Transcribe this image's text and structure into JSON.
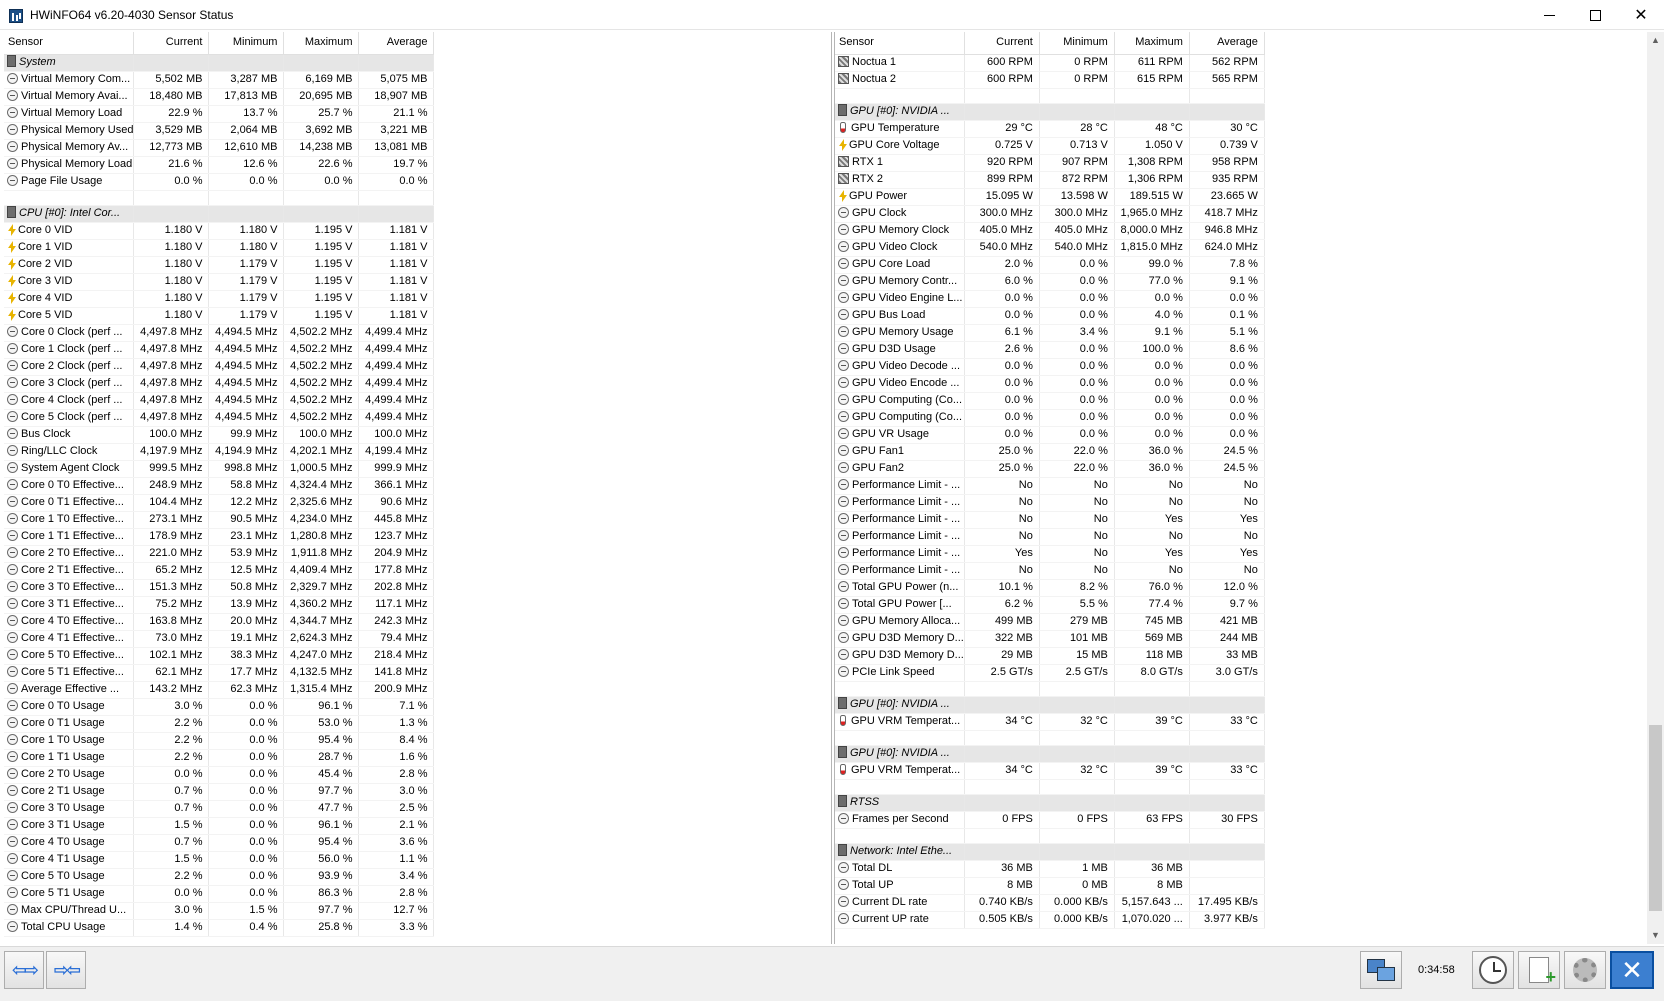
{
  "window": {
    "title": "HWiNFO64 v6.20-4030 Sensor Status"
  },
  "columns": {
    "sensor": "Sensor",
    "current": "Current",
    "minimum": "Minimum",
    "maximum": "Maximum",
    "average": "Average"
  },
  "left_rows": [
    {
      "type": "group",
      "icon": "chip-icon",
      "name": "System"
    },
    {
      "type": "row",
      "icon": "clock-icon",
      "name": "Virtual Memory Com...",
      "cur": "5,502 MB",
      "min": "3,287 MB",
      "max": "6,169 MB",
      "avg": "5,075 MB"
    },
    {
      "type": "row",
      "icon": "clock-icon",
      "name": "Virtual Memory Avai...",
      "cur": "18,480 MB",
      "min": "17,813 MB",
      "max": "20,695 MB",
      "avg": "18,907 MB"
    },
    {
      "type": "row",
      "icon": "clock-icon",
      "name": "Virtual Memory Load",
      "cur": "22.9 %",
      "min": "13.7 %",
      "max": "25.7 %",
      "avg": "21.1 %"
    },
    {
      "type": "row",
      "icon": "clock-icon",
      "name": "Physical Memory Used",
      "cur": "3,529 MB",
      "min": "2,064 MB",
      "max": "3,692 MB",
      "avg": "3,221 MB"
    },
    {
      "type": "row",
      "icon": "clock-icon",
      "name": "Physical Memory Av...",
      "cur": "12,773 MB",
      "min": "12,610 MB",
      "max": "14,238 MB",
      "avg": "13,081 MB"
    },
    {
      "type": "row",
      "icon": "clock-icon",
      "name": "Physical Memory Load",
      "cur": "21.6 %",
      "min": "12.6 %",
      "max": "22.6 %",
      "avg": "19.7 %"
    },
    {
      "type": "row",
      "icon": "clock-icon",
      "name": "Page File Usage",
      "cur": "0.0 %",
      "min": "0.0 %",
      "max": "0.0 %",
      "avg": "0.0 %"
    },
    {
      "type": "blank"
    },
    {
      "type": "group",
      "icon": "chip-icon",
      "name": "CPU [#0]: Intel Cor..."
    },
    {
      "type": "row",
      "icon": "bolt-icon",
      "name": "Core 0 VID",
      "cur": "1.180 V",
      "min": "1.180 V",
      "max": "1.195 V",
      "avg": "1.181 V"
    },
    {
      "type": "row",
      "icon": "bolt-icon",
      "name": "Core 1 VID",
      "cur": "1.180 V",
      "min": "1.180 V",
      "max": "1.195 V",
      "avg": "1.181 V"
    },
    {
      "type": "row",
      "icon": "bolt-icon",
      "name": "Core 2 VID",
      "cur": "1.180 V",
      "min": "1.179 V",
      "max": "1.195 V",
      "avg": "1.181 V"
    },
    {
      "type": "row",
      "icon": "bolt-icon",
      "name": "Core 3 VID",
      "cur": "1.180 V",
      "min": "1.179 V",
      "max": "1.195 V",
      "avg": "1.181 V"
    },
    {
      "type": "row",
      "icon": "bolt-icon",
      "name": "Core 4 VID",
      "cur": "1.180 V",
      "min": "1.179 V",
      "max": "1.195 V",
      "avg": "1.181 V"
    },
    {
      "type": "row",
      "icon": "bolt-icon",
      "name": "Core 5 VID",
      "cur": "1.180 V",
      "min": "1.179 V",
      "max": "1.195 V",
      "avg": "1.181 V"
    },
    {
      "type": "row",
      "icon": "clock-icon",
      "name": "Core 0 Clock (perf ...",
      "cur": "4,497.8 MHz",
      "min": "4,494.5 MHz",
      "max": "4,502.2 MHz",
      "avg": "4,499.4 MHz"
    },
    {
      "type": "row",
      "icon": "clock-icon",
      "name": "Core 1 Clock (perf ...",
      "cur": "4,497.8 MHz",
      "min": "4,494.5 MHz",
      "max": "4,502.2 MHz",
      "avg": "4,499.4 MHz"
    },
    {
      "type": "row",
      "icon": "clock-icon",
      "name": "Core 2 Clock (perf ...",
      "cur": "4,497.8 MHz",
      "min": "4,494.5 MHz",
      "max": "4,502.2 MHz",
      "avg": "4,499.4 MHz"
    },
    {
      "type": "row",
      "icon": "clock-icon",
      "name": "Core 3 Clock (perf ...",
      "cur": "4,497.8 MHz",
      "min": "4,494.5 MHz",
      "max": "4,502.2 MHz",
      "avg": "4,499.4 MHz"
    },
    {
      "type": "row",
      "icon": "clock-icon",
      "name": "Core 4 Clock (perf ...",
      "cur": "4,497.8 MHz",
      "min": "4,494.5 MHz",
      "max": "4,502.2 MHz",
      "avg": "4,499.4 MHz"
    },
    {
      "type": "row",
      "icon": "clock-icon",
      "name": "Core 5 Clock (perf ...",
      "cur": "4,497.8 MHz",
      "min": "4,494.5 MHz",
      "max": "4,502.2 MHz",
      "avg": "4,499.4 MHz"
    },
    {
      "type": "row",
      "icon": "clock-icon",
      "name": "Bus Clock",
      "cur": "100.0 MHz",
      "min": "99.9 MHz",
      "max": "100.0 MHz",
      "avg": "100.0 MHz"
    },
    {
      "type": "row",
      "icon": "clock-icon",
      "name": "Ring/LLC Clock",
      "cur": "4,197.9 MHz",
      "min": "4,194.9 MHz",
      "max": "4,202.1 MHz",
      "avg": "4,199.4 MHz"
    },
    {
      "type": "row",
      "icon": "clock-icon",
      "name": "System Agent Clock",
      "cur": "999.5 MHz",
      "min": "998.8 MHz",
      "max": "1,000.5 MHz",
      "avg": "999.9 MHz"
    },
    {
      "type": "row",
      "icon": "clock-icon",
      "name": "Core 0 T0 Effective...",
      "cur": "248.9 MHz",
      "min": "58.8 MHz",
      "max": "4,324.4 MHz",
      "avg": "366.1 MHz"
    },
    {
      "type": "row",
      "icon": "clock-icon",
      "name": "Core 0 T1 Effective...",
      "cur": "104.4 MHz",
      "min": "12.2 MHz",
      "max": "2,325.6 MHz",
      "avg": "90.6 MHz"
    },
    {
      "type": "row",
      "icon": "clock-icon",
      "name": "Core 1 T0 Effective...",
      "cur": "273.1 MHz",
      "min": "90.5 MHz",
      "max": "4,234.0 MHz",
      "avg": "445.8 MHz"
    },
    {
      "type": "row",
      "icon": "clock-icon",
      "name": "Core 1 T1 Effective...",
      "cur": "178.9 MHz",
      "min": "23.1 MHz",
      "max": "1,280.8 MHz",
      "avg": "123.7 MHz"
    },
    {
      "type": "row",
      "icon": "clock-icon",
      "name": "Core 2 T0 Effective...",
      "cur": "221.0 MHz",
      "min": "53.9 MHz",
      "max": "1,911.8 MHz",
      "avg": "204.9 MHz"
    },
    {
      "type": "row",
      "icon": "clock-icon",
      "name": "Core 2 T1 Effective...",
      "cur": "65.2 MHz",
      "min": "12.5 MHz",
      "max": "4,409.4 MHz",
      "avg": "177.8 MHz"
    },
    {
      "type": "row",
      "icon": "clock-icon",
      "name": "Core 3 T0 Effective...",
      "cur": "151.3 MHz",
      "min": "50.8 MHz",
      "max": "2,329.7 MHz",
      "avg": "202.8 MHz"
    },
    {
      "type": "row",
      "icon": "clock-icon",
      "name": "Core 3 T1 Effective...",
      "cur": "75.2 MHz",
      "min": "13.9 MHz",
      "max": "4,360.2 MHz",
      "avg": "117.1 MHz"
    },
    {
      "type": "row",
      "icon": "clock-icon",
      "name": "Core 4 T0 Effective...",
      "cur": "163.8 MHz",
      "min": "20.0 MHz",
      "max": "4,344.7 MHz",
      "avg": "242.3 MHz"
    },
    {
      "type": "row",
      "icon": "clock-icon",
      "name": "Core 4 T1 Effective...",
      "cur": "73.0 MHz",
      "min": "19.1 MHz",
      "max": "2,624.3 MHz",
      "avg": "79.4 MHz"
    },
    {
      "type": "row",
      "icon": "clock-icon",
      "name": "Core 5 T0 Effective...",
      "cur": "102.1 MHz",
      "min": "38.3 MHz",
      "max": "4,247.0 MHz",
      "avg": "218.4 MHz"
    },
    {
      "type": "row",
      "icon": "clock-icon",
      "name": "Core 5 T1 Effective...",
      "cur": "62.1 MHz",
      "min": "17.7 MHz",
      "max": "4,132.5 MHz",
      "avg": "141.8 MHz"
    },
    {
      "type": "row",
      "icon": "clock-icon",
      "name": "Average Effective ...",
      "cur": "143.2 MHz",
      "min": "62.3 MHz",
      "max": "1,315.4 MHz",
      "avg": "200.9 MHz"
    },
    {
      "type": "row",
      "icon": "clock-icon",
      "name": "Core 0 T0 Usage",
      "cur": "3.0 %",
      "min": "0.0 %",
      "max": "96.1 %",
      "avg": "7.1 %"
    },
    {
      "type": "row",
      "icon": "clock-icon",
      "name": "Core 0 T1 Usage",
      "cur": "2.2 %",
      "min": "0.0 %",
      "max": "53.0 %",
      "avg": "1.3 %"
    },
    {
      "type": "row",
      "icon": "clock-icon",
      "name": "Core 1 T0 Usage",
      "cur": "2.2 %",
      "min": "0.0 %",
      "max": "95.4 %",
      "avg": "8.4 %"
    },
    {
      "type": "row",
      "icon": "clock-icon",
      "name": "Core 1 T1 Usage",
      "cur": "2.2 %",
      "min": "0.0 %",
      "max": "28.7 %",
      "avg": "1.6 %"
    },
    {
      "type": "row",
      "icon": "clock-icon",
      "name": "Core 2 T0 Usage",
      "cur": "0.0 %",
      "min": "0.0 %",
      "max": "45.4 %",
      "avg": "2.8 %"
    },
    {
      "type": "row",
      "icon": "clock-icon",
      "name": "Core 2 T1 Usage",
      "cur": "0.7 %",
      "min": "0.0 %",
      "max": "97.7 %",
      "avg": "3.0 %"
    },
    {
      "type": "row",
      "icon": "clock-icon",
      "name": "Core 3 T0 Usage",
      "cur": "0.7 %",
      "min": "0.0 %",
      "max": "47.7 %",
      "avg": "2.5 %"
    },
    {
      "type": "row",
      "icon": "clock-icon",
      "name": "Core 3 T1 Usage",
      "cur": "1.5 %",
      "min": "0.0 %",
      "max": "96.1 %",
      "avg": "2.1 %"
    },
    {
      "type": "row",
      "icon": "clock-icon",
      "name": "Core 4 T0 Usage",
      "cur": "0.7 %",
      "min": "0.0 %",
      "max": "95.4 %",
      "avg": "3.6 %"
    },
    {
      "type": "row",
      "icon": "clock-icon",
      "name": "Core 4 T1 Usage",
      "cur": "1.5 %",
      "min": "0.0 %",
      "max": "56.0 %",
      "avg": "1.1 %"
    },
    {
      "type": "row",
      "icon": "clock-icon",
      "name": "Core 5 T0 Usage",
      "cur": "2.2 %",
      "min": "0.0 %",
      "max": "93.9 %",
      "avg": "3.4 %"
    },
    {
      "type": "row",
      "icon": "clock-icon",
      "name": "Core 5 T1 Usage",
      "cur": "0.0 %",
      "min": "0.0 %",
      "max": "86.3 %",
      "avg": "2.8 %"
    },
    {
      "type": "row",
      "icon": "clock-icon",
      "name": "Max CPU/Thread U...",
      "cur": "3.0 %",
      "min": "1.5 %",
      "max": "97.7 %",
      "avg": "12.7 %"
    },
    {
      "type": "row",
      "icon": "clock-icon",
      "name": "Total CPU Usage",
      "cur": "1.4 %",
      "min": "0.4 %",
      "max": "25.8 %",
      "avg": "3.3 %"
    }
  ],
  "right_rows": [
    {
      "type": "row",
      "icon": "fan-icon",
      "name": "Noctua 1",
      "cur": "600 RPM",
      "min": "0 RPM",
      "max": "611 RPM",
      "avg": "562 RPM"
    },
    {
      "type": "row",
      "icon": "fan-icon",
      "name": "Noctua 2",
      "cur": "600 RPM",
      "min": "0 RPM",
      "max": "615 RPM",
      "avg": "565 RPM"
    },
    {
      "type": "blank"
    },
    {
      "type": "group",
      "icon": "chip-icon",
      "name": "GPU [#0]: NVIDIA ..."
    },
    {
      "type": "row",
      "icon": "thermometer-icon",
      "name": "GPU Temperature",
      "cur": "29 °C",
      "min": "28 °C",
      "max": "48 °C",
      "avg": "30 °C"
    },
    {
      "type": "row",
      "icon": "bolt-icon",
      "name": "GPU Core Voltage",
      "cur": "0.725 V",
      "min": "0.713 V",
      "max": "1.050 V",
      "avg": "0.739 V"
    },
    {
      "type": "row",
      "icon": "fan-icon",
      "name": "RTX 1",
      "cur": "920 RPM",
      "min": "907 RPM",
      "max": "1,308 RPM",
      "avg": "958 RPM"
    },
    {
      "type": "row",
      "icon": "fan-icon",
      "name": "RTX 2",
      "cur": "899 RPM",
      "min": "872 RPM",
      "max": "1,306 RPM",
      "avg": "935 RPM"
    },
    {
      "type": "row",
      "icon": "bolt-icon",
      "name": "GPU Power",
      "cur": "15.095 W",
      "min": "13.598 W",
      "max": "189.515 W",
      "avg": "23.665 W"
    },
    {
      "type": "row",
      "icon": "clock-icon",
      "name": "GPU Clock",
      "cur": "300.0 MHz",
      "min": "300.0 MHz",
      "max": "1,965.0 MHz",
      "avg": "418.7 MHz"
    },
    {
      "type": "row",
      "icon": "clock-icon",
      "name": "GPU Memory Clock",
      "cur": "405.0 MHz",
      "min": "405.0 MHz",
      "max": "8,000.0 MHz",
      "avg": "946.8 MHz"
    },
    {
      "type": "row",
      "icon": "clock-icon",
      "name": "GPU Video Clock",
      "cur": "540.0 MHz",
      "min": "540.0 MHz",
      "max": "1,815.0 MHz",
      "avg": "624.0 MHz"
    },
    {
      "type": "row",
      "icon": "clock-icon",
      "name": "GPU Core Load",
      "cur": "2.0 %",
      "min": "0.0 %",
      "max": "99.0 %",
      "avg": "7.8 %"
    },
    {
      "type": "row",
      "icon": "clock-icon",
      "name": "GPU Memory Contr...",
      "cur": "6.0 %",
      "min": "0.0 %",
      "max": "77.0 %",
      "avg": "9.1 %"
    },
    {
      "type": "row",
      "icon": "clock-icon",
      "name": "GPU Video Engine L...",
      "cur": "0.0 %",
      "min": "0.0 %",
      "max": "0.0 %",
      "avg": "0.0 %"
    },
    {
      "type": "row",
      "icon": "clock-icon",
      "name": "GPU Bus Load",
      "cur": "0.0 %",
      "min": "0.0 %",
      "max": "4.0 %",
      "avg": "0.1 %"
    },
    {
      "type": "row",
      "icon": "clock-icon",
      "name": "GPU Memory Usage",
      "cur": "6.1 %",
      "min": "3.4 %",
      "max": "9.1 %",
      "avg": "5.1 %"
    },
    {
      "type": "row",
      "icon": "clock-icon",
      "name": "GPU D3D Usage",
      "cur": "2.6 %",
      "min": "0.0 %",
      "max": "100.0 %",
      "avg": "8.6 %"
    },
    {
      "type": "row",
      "icon": "clock-icon",
      "name": "GPU Video Decode ...",
      "cur": "0.0 %",
      "min": "0.0 %",
      "max": "0.0 %",
      "avg": "0.0 %"
    },
    {
      "type": "row",
      "icon": "clock-icon",
      "name": "GPU Video Encode ...",
      "cur": "0.0 %",
      "min": "0.0 %",
      "max": "0.0 %",
      "avg": "0.0 %"
    },
    {
      "type": "row",
      "icon": "clock-icon",
      "name": "GPU Computing (Co...",
      "cur": "0.0 %",
      "min": "0.0 %",
      "max": "0.0 %",
      "avg": "0.0 %"
    },
    {
      "type": "row",
      "icon": "clock-icon",
      "name": "GPU Computing (Co...",
      "cur": "0.0 %",
      "min": "0.0 %",
      "max": "0.0 %",
      "avg": "0.0 %"
    },
    {
      "type": "row",
      "icon": "clock-icon",
      "name": "GPU VR Usage",
      "cur": "0.0 %",
      "min": "0.0 %",
      "max": "0.0 %",
      "avg": "0.0 %"
    },
    {
      "type": "row",
      "icon": "clock-icon",
      "name": "GPU Fan1",
      "cur": "25.0 %",
      "min": "22.0 %",
      "max": "36.0 %",
      "avg": "24.5 %"
    },
    {
      "type": "row",
      "icon": "clock-icon",
      "name": "GPU Fan2",
      "cur": "25.0 %",
      "min": "22.0 %",
      "max": "36.0 %",
      "avg": "24.5 %"
    },
    {
      "type": "row",
      "icon": "clock-icon",
      "name": "Performance Limit - ...",
      "cur": "No",
      "min": "No",
      "max": "No",
      "avg": "No"
    },
    {
      "type": "row",
      "icon": "clock-icon",
      "name": "Performance Limit - ...",
      "cur": "No",
      "min": "No",
      "max": "No",
      "avg": "No"
    },
    {
      "type": "row",
      "icon": "clock-icon",
      "name": "Performance Limit - ...",
      "cur": "No",
      "min": "No",
      "max": "Yes",
      "avg": "Yes"
    },
    {
      "type": "row",
      "icon": "clock-icon",
      "name": "Performance Limit - ...",
      "cur": "No",
      "min": "No",
      "max": "No",
      "avg": "No"
    },
    {
      "type": "row",
      "icon": "clock-icon",
      "name": "Performance Limit - ...",
      "cur": "Yes",
      "min": "No",
      "max": "Yes",
      "avg": "Yes"
    },
    {
      "type": "row",
      "icon": "clock-icon",
      "name": "Performance Limit - ...",
      "cur": "No",
      "min": "No",
      "max": "No",
      "avg": "No"
    },
    {
      "type": "row",
      "icon": "clock-icon",
      "name": "Total GPU Power (n...",
      "cur": "10.1 %",
      "min": "8.2 %",
      "max": "76.0 %",
      "avg": "12.0 %"
    },
    {
      "type": "row",
      "icon": "clock-icon",
      "name": "Total GPU Power [...",
      "cur": "6.2 %",
      "min": "5.5 %",
      "max": "77.4 %",
      "avg": "9.7 %"
    },
    {
      "type": "row",
      "icon": "clock-icon",
      "name": "GPU Memory Alloca...",
      "cur": "499 MB",
      "min": "279 MB",
      "max": "745 MB",
      "avg": "421 MB"
    },
    {
      "type": "row",
      "icon": "clock-icon",
      "name": "GPU D3D Memory D...",
      "cur": "322 MB",
      "min": "101 MB",
      "max": "569 MB",
      "avg": "244 MB"
    },
    {
      "type": "row",
      "icon": "clock-icon",
      "name": "GPU D3D Memory D...",
      "cur": "29 MB",
      "min": "15 MB",
      "max": "118 MB",
      "avg": "33 MB"
    },
    {
      "type": "row",
      "icon": "clock-icon",
      "name": "PCIe Link Speed",
      "cur": "2.5 GT/s",
      "min": "2.5 GT/s",
      "max": "8.0 GT/s",
      "avg": "3.0 GT/s"
    },
    {
      "type": "blank"
    },
    {
      "type": "group",
      "icon": "chip-icon",
      "name": "GPU [#0]: NVIDIA ..."
    },
    {
      "type": "row",
      "icon": "thermometer-icon",
      "name": "GPU VRM Temperat...",
      "cur": "34 °C",
      "min": "32 °C",
      "max": "39 °C",
      "avg": "33 °C"
    },
    {
      "type": "blank"
    },
    {
      "type": "group",
      "icon": "chip-icon",
      "name": "GPU [#0]: NVIDIA ..."
    },
    {
      "type": "row",
      "icon": "thermometer-icon",
      "name": "GPU VRM Temperat...",
      "cur": "34 °C",
      "min": "32 °C",
      "max": "39 °C",
      "avg": "33 °C"
    },
    {
      "type": "blank"
    },
    {
      "type": "group",
      "icon": "chip-icon",
      "name": "RTSS"
    },
    {
      "type": "row",
      "icon": "clock-icon",
      "name": "Frames per Second",
      "cur": "0 FPS",
      "min": "0 FPS",
      "max": "63 FPS",
      "avg": "30 FPS"
    },
    {
      "type": "blank"
    },
    {
      "type": "group",
      "icon": "chip-icon",
      "name": "Network: Intel Ethe..."
    },
    {
      "type": "row",
      "icon": "clock-icon",
      "name": "Total DL",
      "cur": "36 MB",
      "min": "1 MB",
      "max": "36 MB",
      "avg": ""
    },
    {
      "type": "row",
      "icon": "clock-icon",
      "name": "Total UP",
      "cur": "8 MB",
      "min": "0 MB",
      "max": "8 MB",
      "avg": ""
    },
    {
      "type": "row",
      "icon": "clock-icon",
      "name": "Current DL rate",
      "cur": "0.740 KB/s",
      "min": "0.000 KB/s",
      "max": "5,157.643 ...",
      "avg": "17.495 KB/s"
    },
    {
      "type": "row",
      "icon": "clock-icon",
      "name": "Current UP rate",
      "cur": "0.505 KB/s",
      "min": "0.000 KB/s",
      "max": "1,070.020 ...",
      "avg": "3.977 KB/s"
    }
  ],
  "footer": {
    "elapsed_time": "0:34:58"
  },
  "scrollbar": {
    "up_arrow": "▲",
    "down_arrow": "▼"
  },
  "nav": {
    "left_button_glyph": "⇦⇨",
    "right_button_glyph": "⇨⇦"
  }
}
